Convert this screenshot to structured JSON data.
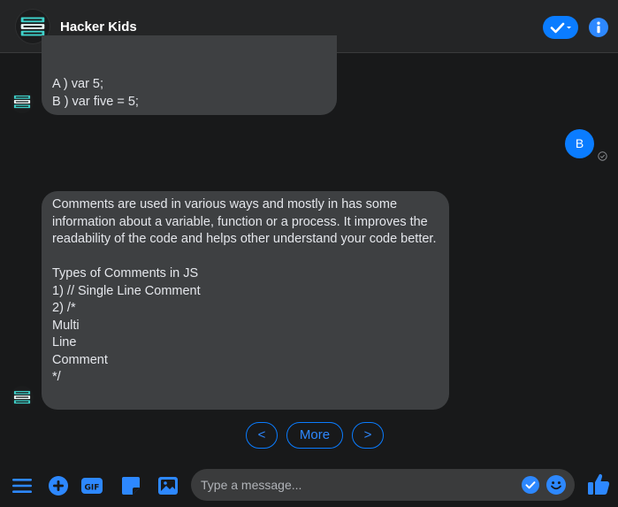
{
  "header": {
    "title": "Hacker Kids",
    "avatar_icon": "kids-who-code-logo",
    "check_icon": "checkmark-dropdown-icon",
    "info_icon": "info-icon"
  },
  "messages": [
    {
      "from": "bot",
      "text": "A ) var 5;\nB ) var five = 5;"
    },
    {
      "from": "user",
      "text": "B"
    },
    {
      "from": "bot",
      "text": "Comments are used in various ways and mostly in has some information about a variable, function or a process. It improves the readability of the code and helps other understand your code better.\n\nTypes of Comments in JS\n1) // Single Line Comment\n2) /*\nMulti\nLine\nComment\n*/"
    }
  ],
  "quick_replies": {
    "prev": "<",
    "more": "More",
    "next": ">"
  },
  "composer": {
    "placeholder": "Type a message...",
    "icons": [
      "menu-icon",
      "plus-icon",
      "gif-icon",
      "sticker-icon",
      "photo-icon",
      "check-icon",
      "emoji-icon",
      "thumbs-up-icon"
    ]
  },
  "colors": {
    "background": "#18191a",
    "header": "#242526",
    "bubble": "#3e4042",
    "accent": "#0a7cff"
  }
}
